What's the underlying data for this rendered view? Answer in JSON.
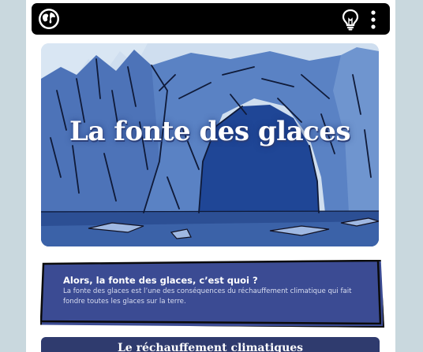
{
  "app": {
    "logo_icon": "globe-icon",
    "actions": [
      {
        "icon": "lightbulb-icon"
      },
      {
        "icon": "kebab-menu-icon"
      }
    ]
  },
  "hero": {
    "title": "La fonte des glaces",
    "image": "ice-arch-illustration"
  },
  "card": {
    "title": "Alors, la fonte des glaces, c’est quoi ?",
    "text": "La fonte des glaces est l’une des  conséquences du réchauffement climatique qui fait fondre toutes les glaces sur la terre."
  },
  "section": {
    "title": "Le réchauffement climatiques"
  },
  "colors": {
    "background": "#c9d8de",
    "topbar": "#000000",
    "card": "#3b4b93",
    "section": "#2f3b6e"
  }
}
